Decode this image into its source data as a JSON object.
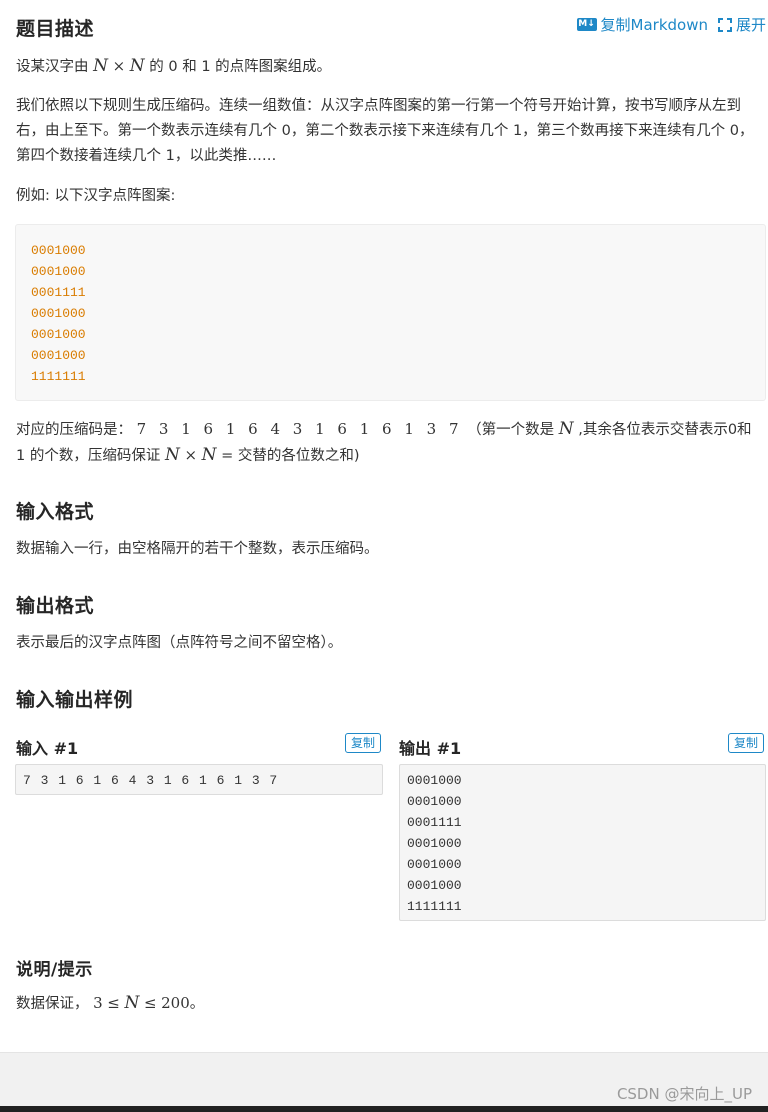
{
  "header": {
    "title": "题目描述",
    "copy_markdown_label": "复制Markdown",
    "expand_label": "展开",
    "md_badge": "M↓"
  },
  "description": {
    "line1_prefix": "设某汉字由",
    "line1_suffix": "的 0 和 1 的点阵图案组成。",
    "para2": "我们依照以下规则生成压缩码。连续一组数值：从汉字点阵图案的第一行第一个符号开始计算，按书写顺序从左到右，由上至下。第一个数表示连续有几个 0，第二个数表示接下来连续有几个 1，第三个数再接下来连续有几个 0，第四个数接着连续几个 1，以此类推……",
    "example_intro": "例如: 以下汉字点阵图案:",
    "pattern": [
      "0001000",
      "0001000",
      "0001111",
      "0001000",
      "0001000",
      "0001000",
      "1111111"
    ],
    "code_prefix": "对应的压缩码是：",
    "code_values": "7 3 1 6 1 6 4 3 1 6 1 6 1 3 7",
    "code_note_a": "（第一个数是",
    "code_note_b": ",其余各位表示交替表示0和1 的个数，压缩码保证",
    "code_note_c": "= 交替的各位数之和)"
  },
  "input_format": {
    "title": "输入格式",
    "text": "数据输入一行，由空格隔开的若干个整数，表示压缩码。"
  },
  "output_format": {
    "title": "输出格式",
    "text": "表示最后的汉字点阵图（点阵符号之间不留空格）。"
  },
  "samples": {
    "title": "输入输出样例",
    "input_label": "输入 #1",
    "output_label": "输出 #1",
    "copy_label": "复制",
    "input_text": "7 3 1 6 1 6 4 3 1 6 1 6 1 3 7",
    "output_lines": [
      "0001000",
      "0001000",
      "0001111",
      "0001000",
      "0001000",
      "0001000",
      "1111111"
    ]
  },
  "hint": {
    "title": "说明/提示",
    "prefix": "数据保证，",
    "suffix": "。"
  },
  "math": {
    "N": "N",
    "times": "×",
    "le": "≤",
    "three": "3",
    "twohundred": "200"
  },
  "watermark": "CSDN @宋向上_UP"
}
